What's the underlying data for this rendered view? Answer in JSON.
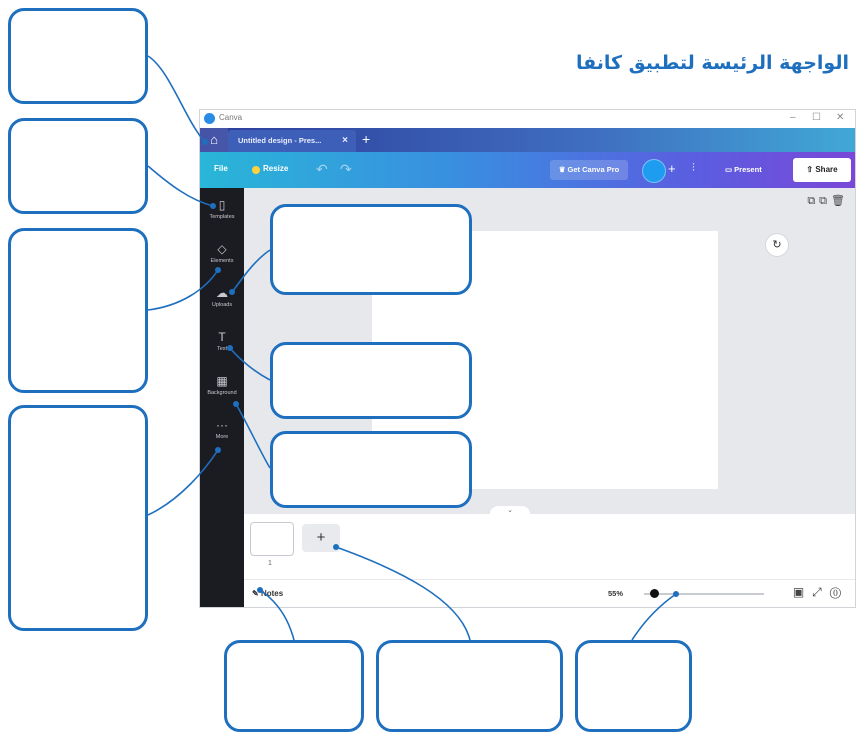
{
  "page_title": "الواجهة الرئيسة لتطبيق كانفا",
  "window": {
    "app_name": "Canva",
    "controls": [
      "–",
      "☐",
      "✕"
    ]
  },
  "tabs": {
    "home_icon": "home-icon",
    "doc_tab_label": "Untitled design - Pres...",
    "close": "×",
    "new_tab": "+"
  },
  "toolbar": {
    "file": "File",
    "resize": "Resize",
    "undo": "↶",
    "redo": "↷",
    "get_pro": "♛ Get Canva Pro",
    "add_member": "+",
    "insights": "⫶",
    "present": "Present",
    "share": "Share"
  },
  "sidebar": {
    "items": [
      {
        "label": "Templates",
        "icon": "▯"
      },
      {
        "label": "Elements",
        "icon": "◇"
      },
      {
        "label": "Uploads",
        "icon": "☁"
      },
      {
        "label": "Text",
        "icon": "T"
      },
      {
        "label": "Background",
        "icon": "▦"
      },
      {
        "label": "More",
        "icon": "···"
      }
    ]
  },
  "canvas": {
    "page_actions": "⧉⧉🗑",
    "refresh": "↻",
    "collapse": "⌄"
  },
  "pages_strip": {
    "page_number": "1",
    "add_page": "+"
  },
  "footer": {
    "notes": "Notes",
    "zoom": "55%",
    "zoom_fraction": 0.08,
    "right_icons": "▣⤢⓪"
  },
  "colors": {
    "callout_blue": "#1f6fbf",
    "sidebar_bg": "#1b1c22",
    "share_bg": "#ffffff"
  }
}
